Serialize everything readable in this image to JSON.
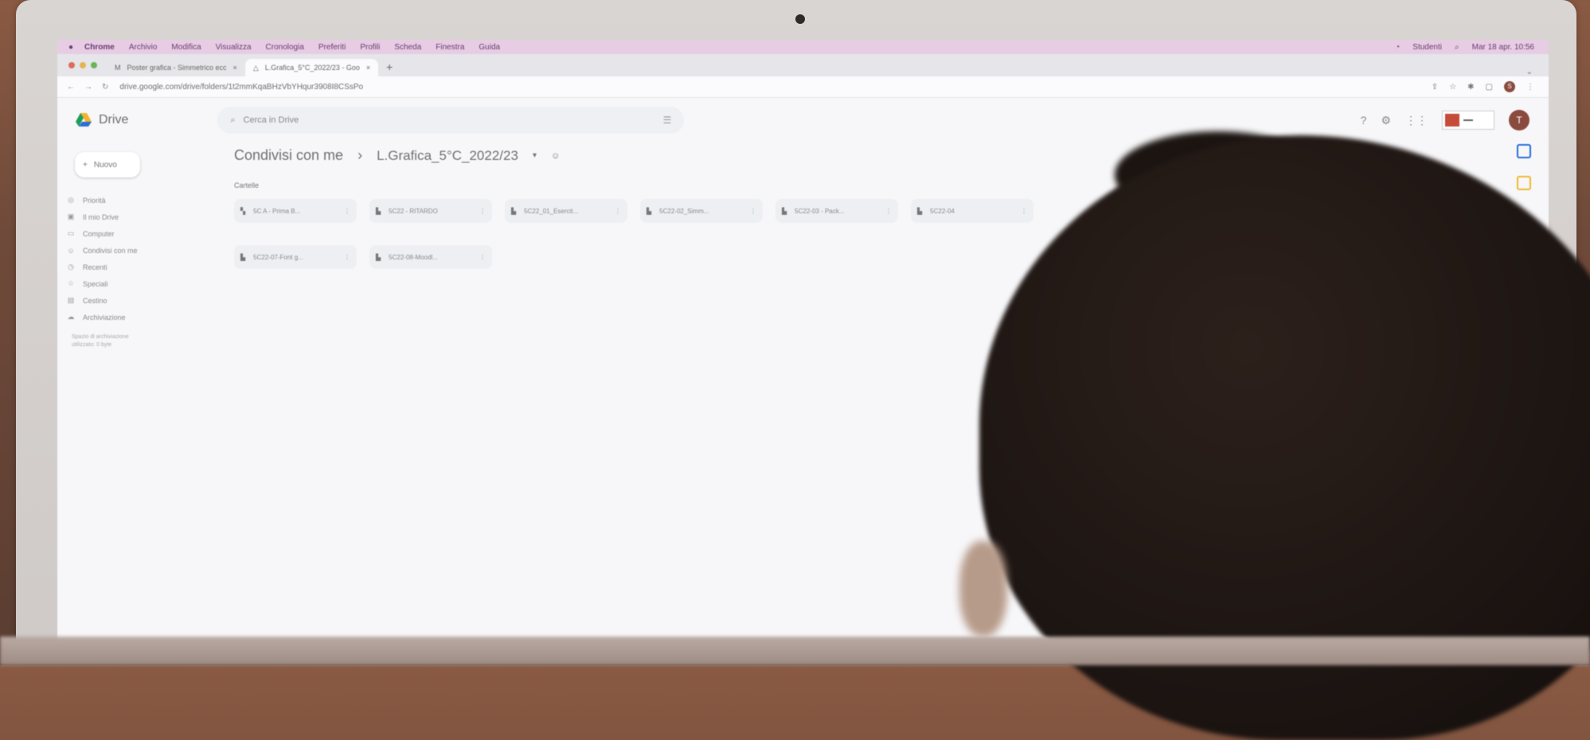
{
  "menubar": {
    "app": "Chrome",
    "items": [
      "Archivio",
      "Modifica",
      "Visualizza",
      "Cronologia",
      "Preferiti",
      "Profili",
      "Scheda",
      "Finestra",
      "Guida"
    ],
    "right": [
      "Studenti",
      "Mar 18 apr. 10:56"
    ]
  },
  "tabs": [
    {
      "title": "Poster grafica - Simmetrico ecc"
    },
    {
      "title": "L.Grafica_5°C_2022/23 - Goo"
    }
  ],
  "url": "drive.google.com/drive/folders/1t2mmKqaBHzVbYHqur3908I8CSsPo",
  "drive": {
    "brand": "Drive",
    "search_placeholder": "Cerca in Drive",
    "new_button": "Nuovo",
    "sidebar": [
      "Priorità",
      "Il mio Drive",
      "Computer",
      "Condivisi con me",
      "Recenti",
      "Speciali",
      "Cestino",
      "Archiviazione"
    ],
    "storage_text": [
      "Spazio di archiviazione",
      "utilizzato: 0 byte"
    ],
    "breadcrumb": {
      "root": "Condivisi con me",
      "current": "L.Grafica_5°C_2022/23"
    },
    "section_label": "Cartelle",
    "folders": [
      "5C A - Prima B...",
      "5C22 - RITARDO",
      "5C22_01_Esercit...",
      "5C22-02_Simm...",
      "5C22-03 - Pack...",
      "5C22-04",
      "5C22-07-Font g...",
      "5C22-08-Moodl..."
    ],
    "avatar_letter": "T"
  },
  "colors": {
    "menubar_bg": "#e7cde3",
    "brand_blue": "#2a6fd6",
    "avatar": "#8a4b3e"
  }
}
